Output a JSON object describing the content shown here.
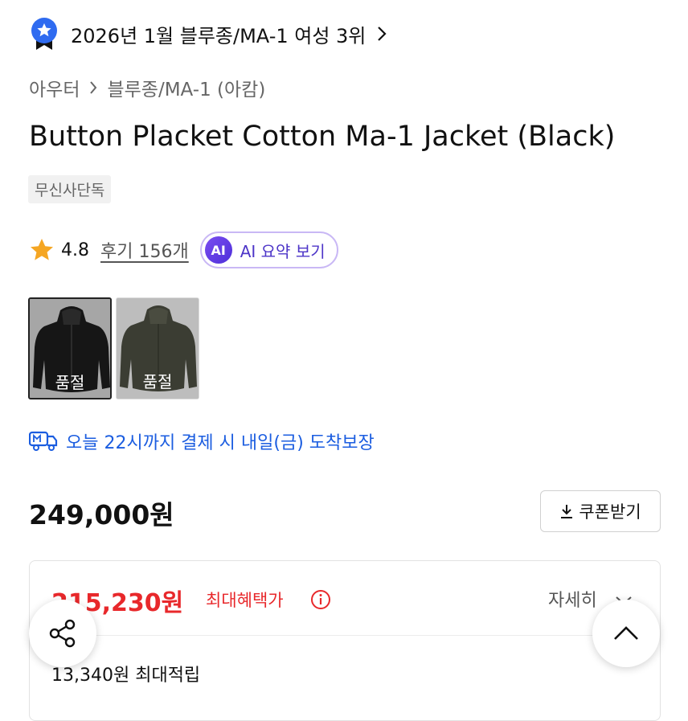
{
  "ranking": {
    "text": "2026년 1월 블루종/MA-1 여성 3위"
  },
  "breadcrumb": {
    "level1": "아우터",
    "level2": "블루종/MA-1 (아캄)"
  },
  "product": {
    "title": "Button Placket Cotton Ma-1 Jacket (Black)",
    "tag": "무신사단독"
  },
  "rating": {
    "score": "4.8",
    "reviews": "후기 156개",
    "ai_badge": "AI",
    "ai_label": "AI 요약 보기"
  },
  "colors": {
    "options": [
      {
        "status": "품절"
      },
      {
        "status": "품절"
      }
    ]
  },
  "delivery": {
    "text": "오늘 22시까지 결제 시 내일(금) 도착보장"
  },
  "price": {
    "original": "249,000원",
    "coupon_button": "쿠폰받기",
    "max_benefit_price": "215,230원",
    "max_benefit_label": "최대혜택가",
    "detail_label": "자세히",
    "max_points": "13,340원 최대적립"
  },
  "theme": {
    "accent_red": "#e8282b",
    "delivery_blue": "#1b5de0",
    "ai_purple": "#4d35c8",
    "star_color": "#f5a623"
  },
  "icons": [
    "rank-badge-icon",
    "chevron-right-icon",
    "star-icon",
    "ai-icon",
    "delivery-truck-icon",
    "download-icon",
    "info-icon",
    "chevron-down-icon",
    "share-icon",
    "chevron-up-icon"
  ]
}
